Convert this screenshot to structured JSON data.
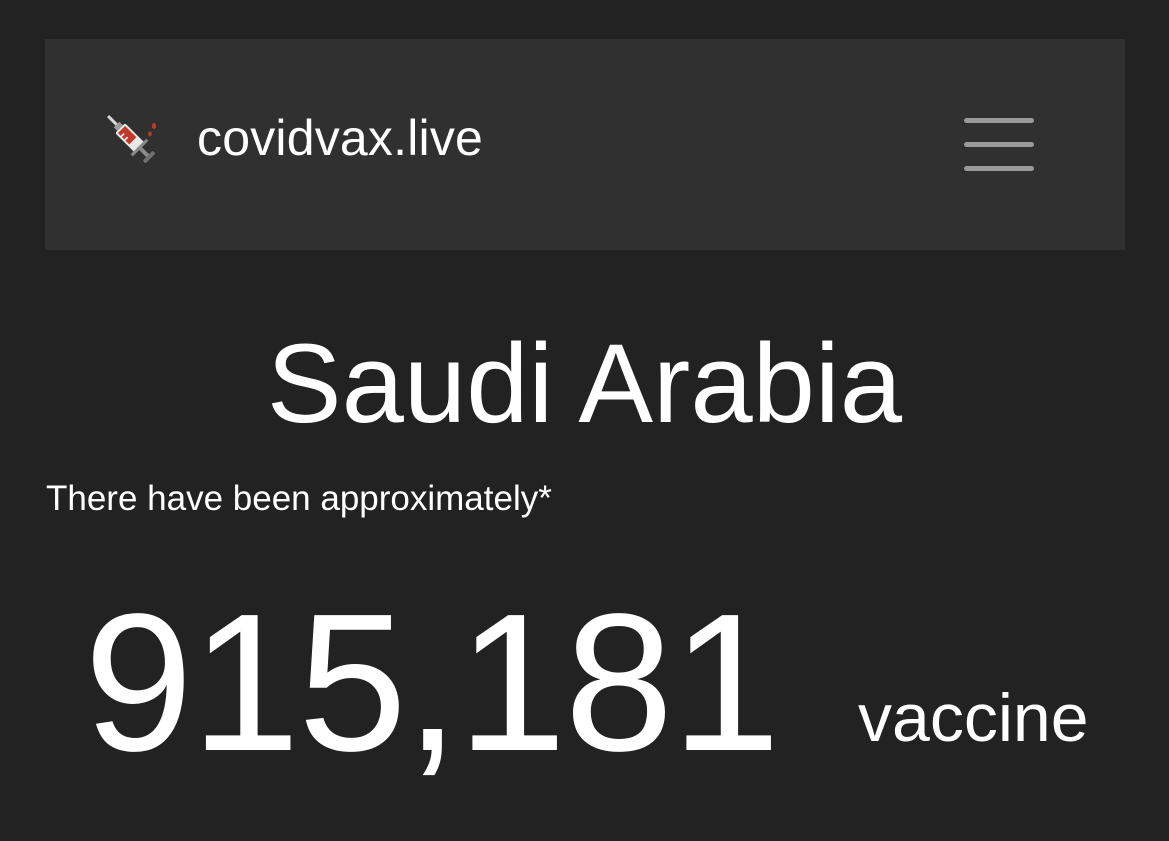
{
  "header": {
    "brand_icon": "syringe-icon",
    "brand_name": "covidvax.live",
    "menu_icon": "hamburger-menu-icon"
  },
  "main": {
    "country": "Saudi Arabia",
    "intro": "There have been approximately*",
    "count": "915,181",
    "unit": "vaccine"
  },
  "colors": {
    "background": "#222222",
    "navbar": "#303030",
    "text": "#ffffff",
    "menu_bars": "#9a9a9a",
    "syringe_liquid": "#c0392b"
  }
}
